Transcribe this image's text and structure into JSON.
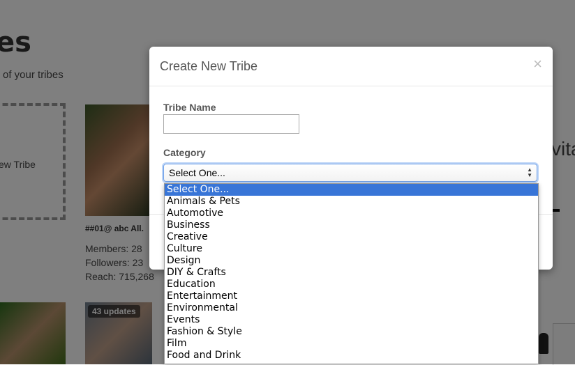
{
  "background": {
    "heading": "es",
    "subheading": "of your tribes",
    "new_tribe_label": "ew Tribe",
    "card": {
      "title": "##01@ abc All.",
      "members": "Members: 28",
      "followers": "Followers: 23",
      "reach": "Reach: 715,268"
    },
    "badge": "43 updates",
    "right_text": "vita"
  },
  "modal": {
    "title": "Create New Tribe",
    "close_glyph": "×",
    "tribe_name_label": "Tribe Name",
    "tribe_name_value": "",
    "category_label": "Category",
    "category_selected": "Select One...",
    "arrow_up": "▲",
    "arrow_down": "▼"
  },
  "dropdown": {
    "options": [
      "Select One...",
      "Animals & Pets",
      "Automotive",
      "Business",
      "Creative",
      "Culture",
      "Design",
      "DIY & Crafts",
      "Education",
      "Entertainment",
      "Environmental",
      "Events",
      "Fashion & Style",
      "Film",
      "Food and Drink"
    ]
  }
}
